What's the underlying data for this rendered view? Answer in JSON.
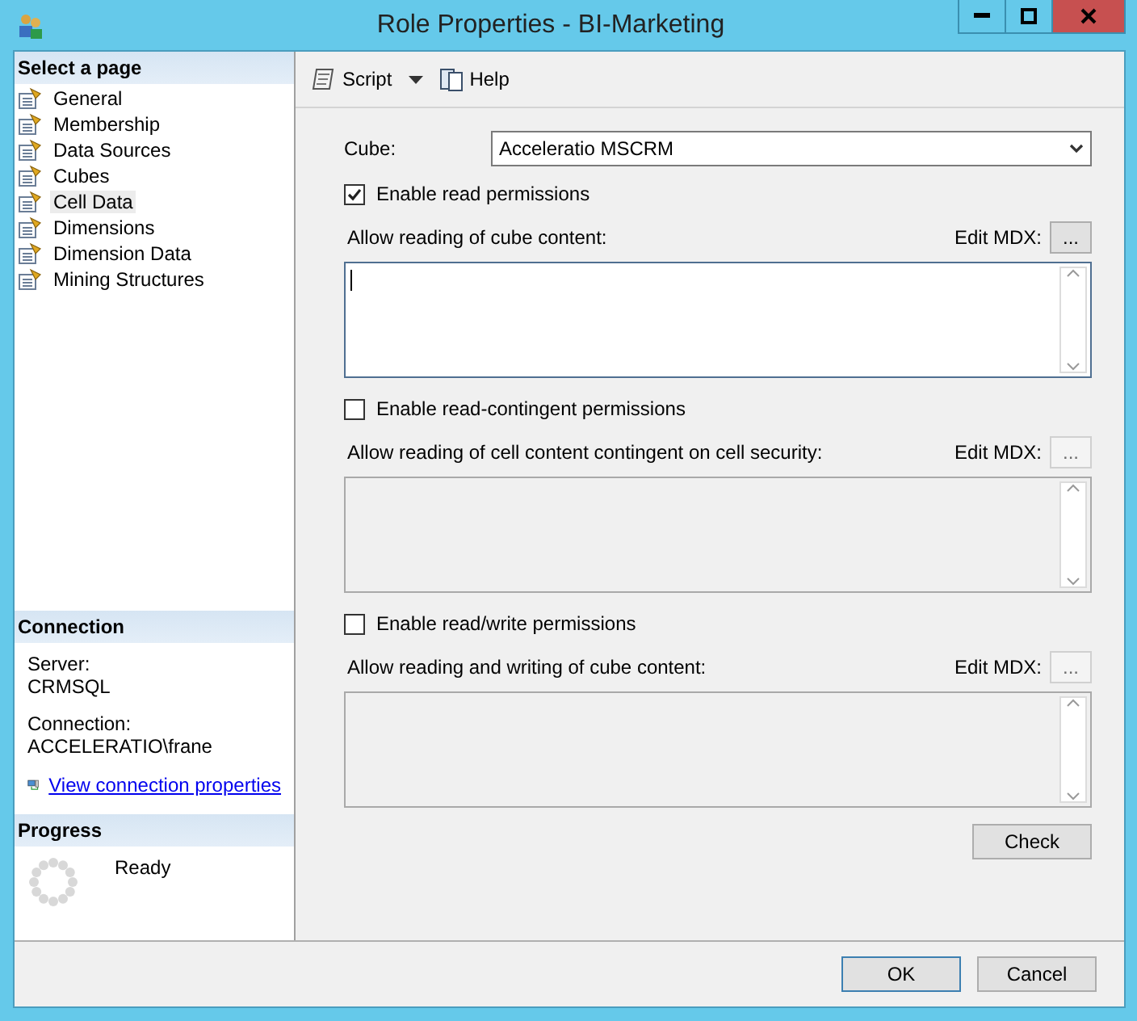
{
  "window": {
    "title": "Role Properties - BI-Marketing"
  },
  "sidebar": {
    "header": "Select a page",
    "items": [
      {
        "label": "General",
        "selected": false
      },
      {
        "label": "Membership",
        "selected": false
      },
      {
        "label": "Data Sources",
        "selected": false
      },
      {
        "label": "Cubes",
        "selected": false
      },
      {
        "label": "Cell Data",
        "selected": true
      },
      {
        "label": "Dimensions",
        "selected": false
      },
      {
        "label": "Dimension Data",
        "selected": false
      },
      {
        "label": "Mining Structures",
        "selected": false
      }
    ]
  },
  "connection": {
    "header": "Connection",
    "fields": [
      {
        "label": "Server:",
        "value": "CRMSQL"
      },
      {
        "label": "Connection:",
        "value": "ACCELERATIO\\frane"
      }
    ],
    "link": "View connection properties"
  },
  "progress": {
    "header": "Progress",
    "status": "Ready"
  },
  "toolbar": {
    "script": "Script",
    "help": "Help"
  },
  "cube": {
    "label": "Cube:",
    "value": "Acceleratio MSCRM"
  },
  "sections": [
    {
      "checkbox_label": "Enable read permissions",
      "checked": true,
      "content_label": "Allow reading of cube content:",
      "edit_label": "Edit MDX:",
      "button": "...",
      "enabled": true
    },
    {
      "checkbox_label": "Enable read-contingent permissions",
      "checked": false,
      "content_label": "Allow reading of cell content contingent on cell security:",
      "edit_label": "Edit MDX:",
      "button": "...",
      "enabled": false
    },
    {
      "checkbox_label": "Enable read/write permissions",
      "checked": false,
      "content_label": "Allow reading and writing of cube content:",
      "edit_label": "Edit MDX:",
      "button": "...",
      "enabled": false
    }
  ],
  "check_button": "Check",
  "footer": {
    "ok": "OK",
    "cancel": "Cancel"
  }
}
